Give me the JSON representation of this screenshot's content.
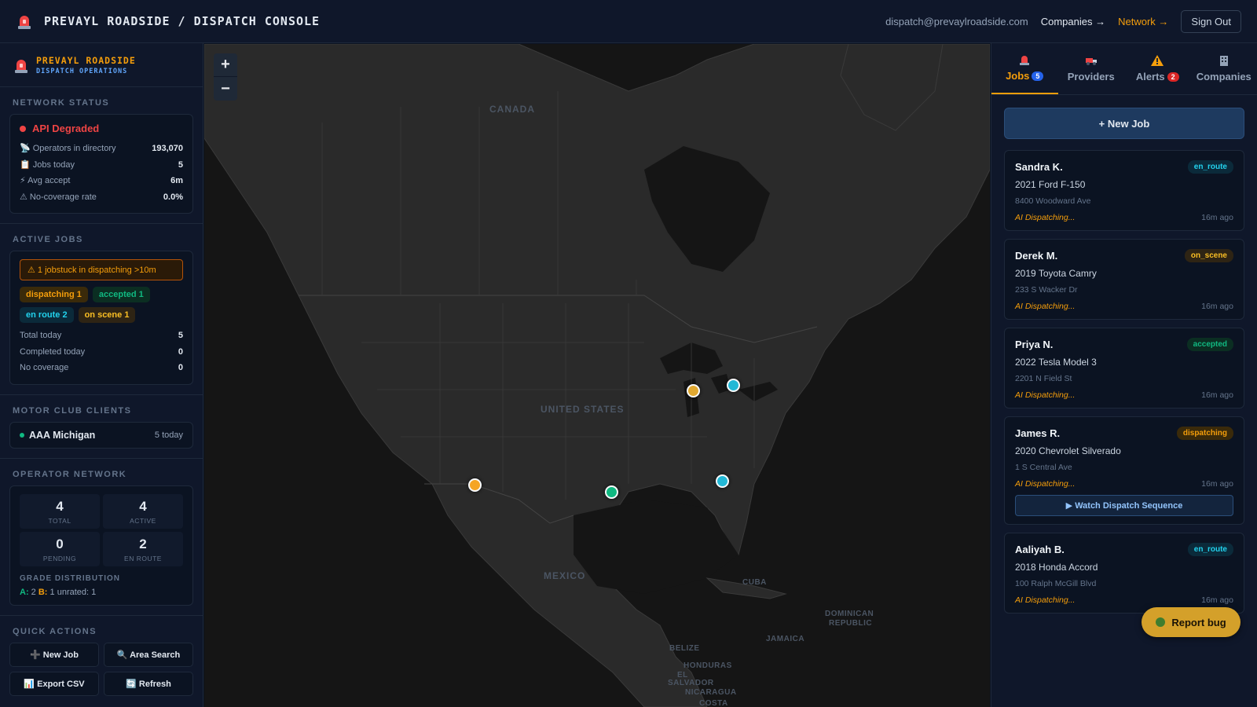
{
  "header": {
    "title": "PREVAYL ROADSIDE / DISPATCH CONSOLE",
    "email": "dispatch@prevaylroadside.com",
    "companies_link": "Companies →",
    "network_link": "Network →",
    "signout": "Sign Out"
  },
  "brand": {
    "name": "PREVAYL ROADSIDE",
    "sub": "DISPATCH OPERATIONS"
  },
  "network_status": {
    "title": "NETWORK STATUS",
    "state": "API Degraded",
    "rows": [
      {
        "label": "📡 Operators in directory",
        "value": "193,070"
      },
      {
        "label": "📋 Jobs today",
        "value": "5"
      },
      {
        "label": "⚡ Avg accept",
        "value": "6m"
      },
      {
        "label": "⚠ No-coverage rate",
        "value": "0.0%"
      }
    ]
  },
  "active_jobs": {
    "title": "ACTIVE JOBS",
    "warning": "⚠ 1 jobstuck in dispatching >10m",
    "badges": {
      "dispatching": "dispatching 1",
      "accepted": "accepted 1",
      "enroute": "en route 2",
      "onscene": "on scene 1"
    },
    "rows": [
      {
        "label": "Total today",
        "value": "5"
      },
      {
        "label": "Completed today",
        "value": "0"
      },
      {
        "label": "No coverage",
        "value": "0"
      }
    ]
  },
  "motor_club": {
    "title": "MOTOR CLUB CLIENTS",
    "client": {
      "name": "AAA Michigan",
      "count": "5 today"
    }
  },
  "operator_network": {
    "title": "OPERATOR NETWORK",
    "stats": [
      {
        "n": "4",
        "l": "TOTAL"
      },
      {
        "n": "4",
        "l": "ACTIVE"
      },
      {
        "n": "0",
        "l": "PENDING"
      },
      {
        "n": "2",
        "l": "EN ROUTE"
      }
    ],
    "grade_title": "GRADE DISTRIBUTION",
    "grade_a": "A:",
    "grade_a_val": "2",
    "grade_b": "B:",
    "grade_b_val": "1",
    "grade_unrated": "unrated: 1"
  },
  "quick_actions": {
    "title": "QUICK ACTIONS",
    "buttons": [
      "➕ New Job",
      "🔍 Area Search",
      "📊 Export CSV",
      "🔄 Refresh"
    ]
  },
  "map": {
    "zoom_in": "+",
    "zoom_out": "−",
    "labels": {
      "canada": "CANADA",
      "us": "UNITED STATES",
      "mexico": "MEXICO",
      "cuba": "CUBA",
      "dominican": "DOMINICAN",
      "republic": "REPUBLIC",
      "jamaica": "JAMAICA",
      "belize": "BELIZE",
      "honduras": "HONDURAS",
      "el": "EL",
      "salvador": "SALVADOR",
      "nicaragua": "NICARAGUA",
      "costa": "COSTA"
    },
    "pin_colors": {
      "onscene": "#e0a830",
      "enroute": "#22b8d6",
      "dispatching": "#f5a524",
      "accepted": "#10b981"
    }
  },
  "tabs": [
    {
      "label": "Jobs",
      "count": "5"
    },
    {
      "label": "Providers"
    },
    {
      "label": "Alerts",
      "count": "2"
    },
    {
      "label": "Companies"
    }
  ],
  "new_job_button": "+ New Job",
  "jobs": [
    {
      "name": "Sandra K.",
      "status": "en_route",
      "vehicle": "2021 Ford F-150",
      "address": "8400 Woodward Ave",
      "ai": "AI Dispatching...",
      "ago": "16m ago"
    },
    {
      "name": "Derek M.",
      "status": "on_scene",
      "vehicle": "2019 Toyota Camry",
      "address": "233 S Wacker Dr",
      "ai": "AI Dispatching...",
      "ago": "16m ago"
    },
    {
      "name": "Priya N.",
      "status": "accepted",
      "vehicle": "2022 Tesla Model 3",
      "address": "2201 N Field St",
      "ai": "AI Dispatching...",
      "ago": "16m ago"
    },
    {
      "name": "James R.",
      "status": "dispatching",
      "vehicle": "2020 Chevrolet Silverado",
      "address": "1 S Central Ave",
      "ai": "AI Dispatching...",
      "ago": "16m ago",
      "watch": "▶ Watch Dispatch Sequence"
    },
    {
      "name": "Aaliyah B.",
      "status": "en_route",
      "vehicle": "2018 Honda Accord",
      "address": "100 Ralph McGill Blvd",
      "ai": "AI Dispatching...",
      "ago": "16m ago"
    }
  ],
  "report_bug": "Report bug",
  "colors": {
    "accent": "#f59e0b",
    "danger": "#ef4444",
    "success": "#10b981",
    "info": "#22d3ee"
  }
}
